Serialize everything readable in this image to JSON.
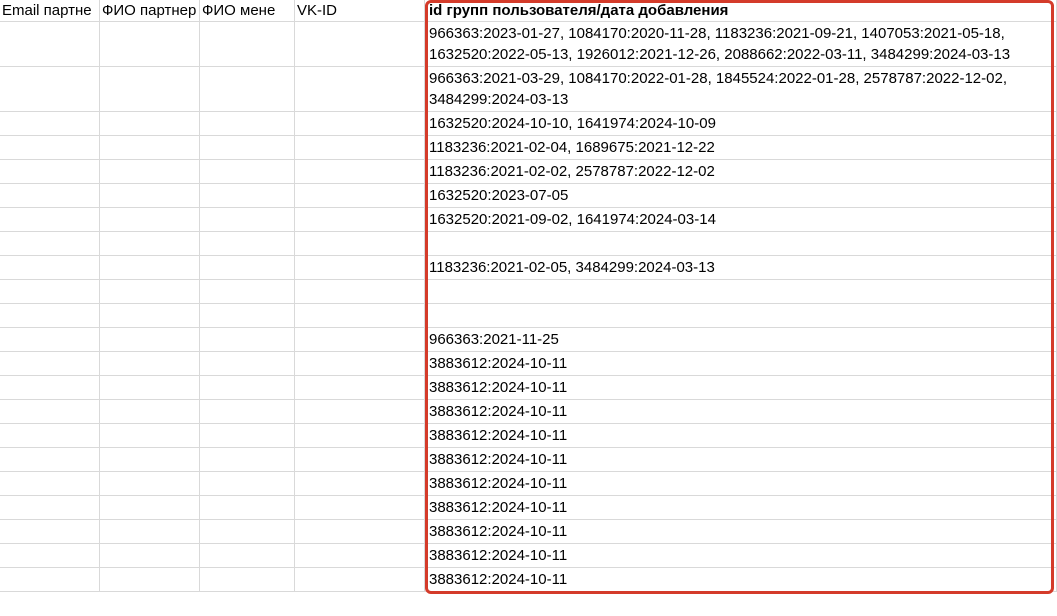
{
  "headers": {
    "col1": "Email партне",
    "col2": "ФИО партнер",
    "col3": "ФИО мене",
    "col4": "VK-ID",
    "col5": "id групп пользователя/дата добавления"
  },
  "col1_values": [
    "",
    "",
    "",
    "",
    "",
    "",
    "",
    "",
    "",
    "",
    "",
    "",
    "",
    "",
    "",
    "",
    "",
    "",
    "",
    "",
    "",
    "",
    ""
  ],
  "col2_values": [
    "",
    "",
    "",
    "",
    "",
    "",
    "",
    "",
    "",
    "",
    "",
    "",
    "",
    "",
    "",
    "",
    "",
    "",
    "",
    "",
    "",
    "",
    ""
  ],
  "col3_values": [
    "",
    "",
    "",
    "",
    "",
    "",
    "",
    "",
    "",
    "",
    "",
    "",
    "",
    "",
    "",
    "",
    "",
    "",
    "",
    "",
    "",
    "",
    ""
  ],
  "col4_values": [
    "",
    "",
    "",
    "",
    "",
    "",
    "",
    "",
    "",
    "",
    "",
    "",
    "",
    "",
    "",
    "",
    "",
    "",
    "",
    "",
    "",
    "",
    ""
  ],
  "data_rows": [
    "966363:2023-01-27, 1084170:2020-11-28, 1183236:2021-09-21, 1407053:2021-05-18, 1632520:2022-05-13, 1926012:2021-12-26, 2088662:2022-03-11, 3484299:2024-03-13",
    "966363:2021-03-29, 1084170:2022-01-28, 1845524:2022-01-28, 2578787:2022-12-02, 3484299:2024-03-13",
    "1632520:2024-10-10, 1641974:2024-10-09",
    "1183236:2021-02-04, 1689675:2021-12-22",
    "1183236:2021-02-02, 2578787:2022-12-02",
    "1632520:2023-07-05",
    "1632520:2021-09-02, 1641974:2024-03-14",
    "",
    "1183236:2021-02-05, 3484299:2024-03-13",
    "",
    "",
    "966363:2021-11-25",
    "3883612:2024-10-11",
    "3883612:2024-10-11",
    "3883612:2024-10-11",
    "3883612:2024-10-11",
    "3883612:2024-10-11",
    "3883612:2024-10-11",
    "3883612:2024-10-11",
    "3883612:2024-10-11",
    "3883612:2024-10-11",
    "3883612:2024-10-11"
  ]
}
